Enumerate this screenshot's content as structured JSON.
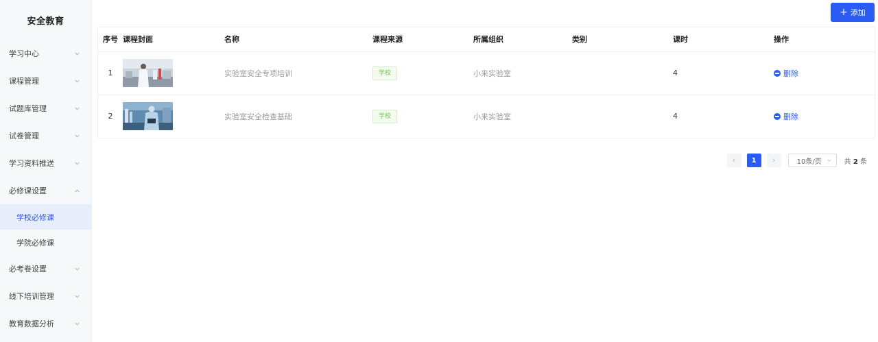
{
  "sidebar": {
    "brand": "安全教育",
    "items": [
      {
        "label": "学习中心",
        "chevron": "down"
      },
      {
        "label": "课程管理",
        "chevron": "down"
      },
      {
        "label": "试题库管理",
        "chevron": "down"
      },
      {
        "label": "试卷管理",
        "chevron": "down"
      },
      {
        "label": "学习资料推送",
        "chevron": "down"
      },
      {
        "label": "必修课设置",
        "chevron": "up"
      },
      {
        "label": "必考卷设置",
        "chevron": "down"
      },
      {
        "label": "线下培训管理",
        "chevron": "down"
      },
      {
        "label": "教育数据分析",
        "chevron": "down"
      }
    ],
    "subitems": [
      {
        "label": "学校必修课",
        "active": true
      },
      {
        "label": "学院必修课",
        "active": false
      }
    ]
  },
  "toolbar": {
    "add_label": "添加",
    "add_icon": "plus-icon"
  },
  "table": {
    "headers": {
      "index": "序号",
      "cover": "课程封面",
      "name": "名称",
      "source": "课程来源",
      "org": "所属组织",
      "category": "类别",
      "hours": "课时",
      "action": "操作"
    },
    "rows": [
      {
        "index": "1",
        "name": "实验室安全专项培训",
        "source": "学校",
        "org": "小来实验室",
        "category": "",
        "hours": "4",
        "action": "删除"
      },
      {
        "index": "2",
        "name": "实验室安全检查基础",
        "source": "学校",
        "org": "小来实验室",
        "category": "",
        "hours": "4",
        "action": "删除"
      }
    ]
  },
  "pagination": {
    "current_page": "1",
    "page_size": "10条/页",
    "total_prefix": "共",
    "total": "2",
    "total_suffix": "条"
  },
  "colors": {
    "accent": "#2a5bf5",
    "tag_green": "#7ac45a",
    "sidebar_bg": "#f7f8fa"
  }
}
